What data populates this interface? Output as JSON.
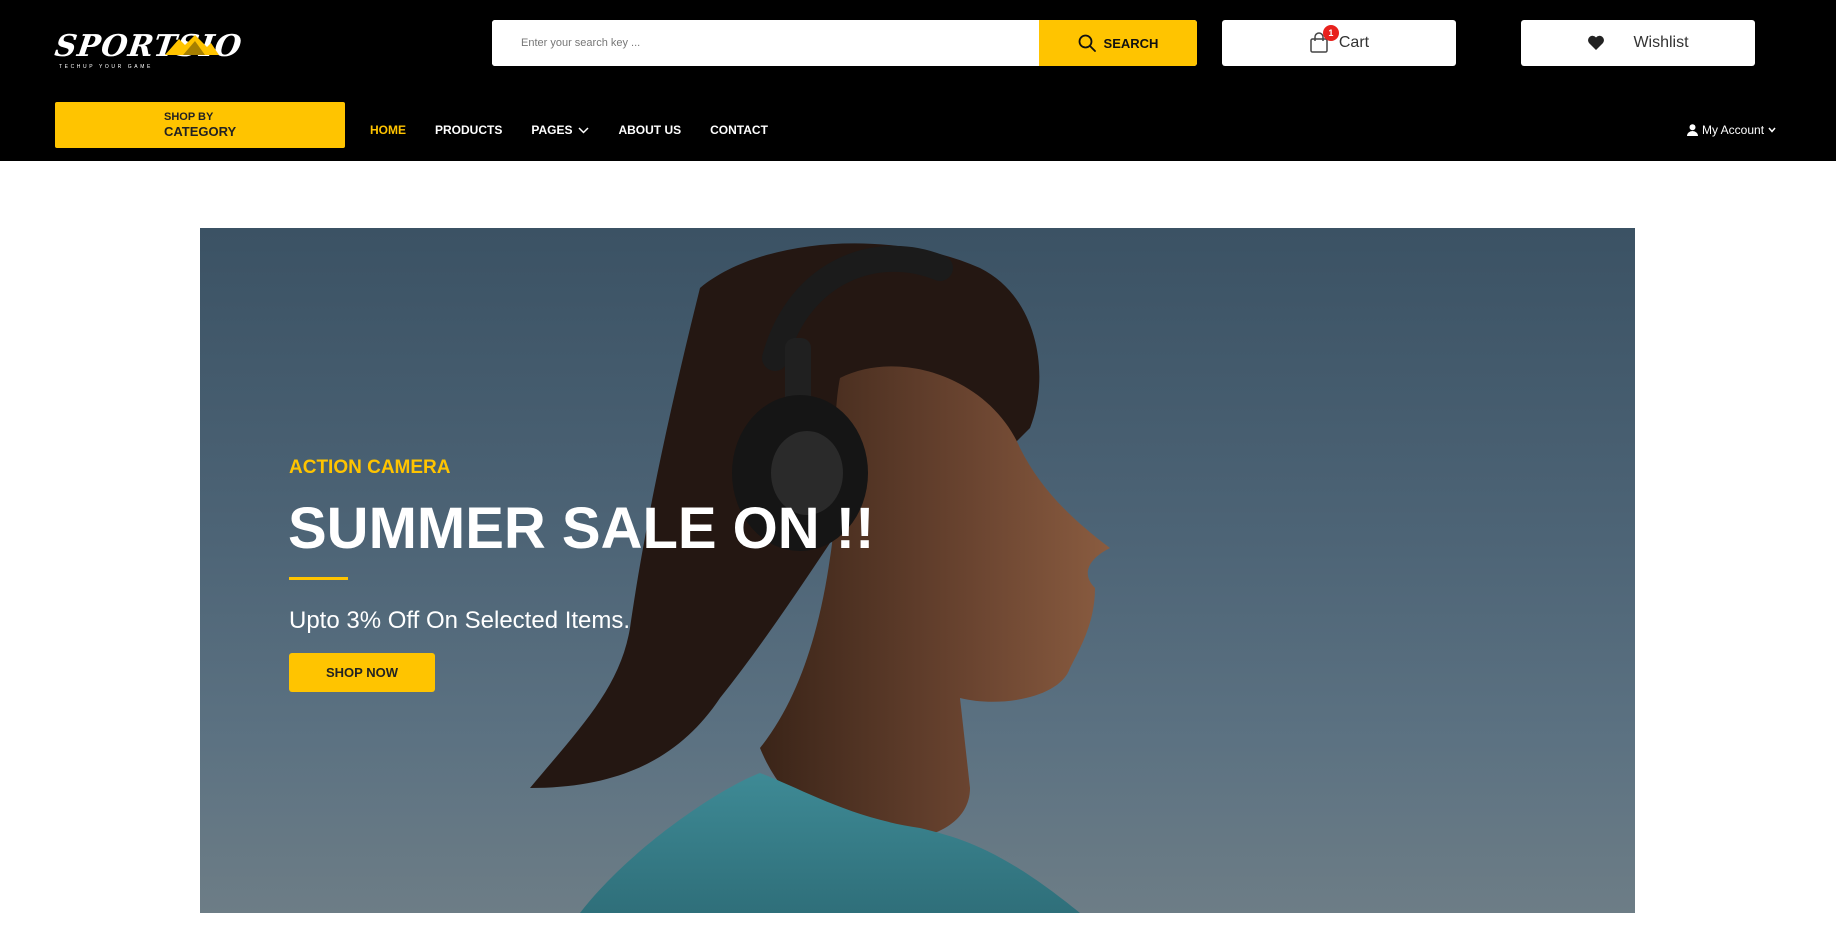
{
  "logo": {
    "name": "SPORTSIO",
    "tagline": "TECHUP YOUR GAME",
    "accent": "#ffc400"
  },
  "search": {
    "placeholder": "Enter your search key ...",
    "value": "",
    "button_label": "SEARCH",
    "icon": "search-icon"
  },
  "cart": {
    "label": "Cart",
    "count": "1",
    "icon": "shopping-bag-icon",
    "badge_color": "#e8211d"
  },
  "wishlist": {
    "label": "Wishlist",
    "icon": "heart-icon"
  },
  "category_button": {
    "line1": "SHOP BY",
    "line2": "CATEGORY"
  },
  "nav": {
    "items": [
      {
        "label": "HOME",
        "active": true
      },
      {
        "label": "PRODUCTS",
        "active": false
      },
      {
        "label": "PAGES",
        "active": false,
        "dropdown": true
      },
      {
        "label": "ABOUT US",
        "active": false
      },
      {
        "label": "CONTACT",
        "active": false
      }
    ]
  },
  "account": {
    "label": "My Account",
    "icon": "user-icon"
  },
  "hero": {
    "eyebrow": "ACTION CAMERA",
    "title": "SUMMER SALE ON !!",
    "subtitle": "Upto 3% Off On Selected Items.",
    "button_label": "SHOP NOW"
  },
  "colors": {
    "brand_yellow": "#ffc400",
    "header_bg": "#000000",
    "hero_bg": "#4d6476"
  }
}
